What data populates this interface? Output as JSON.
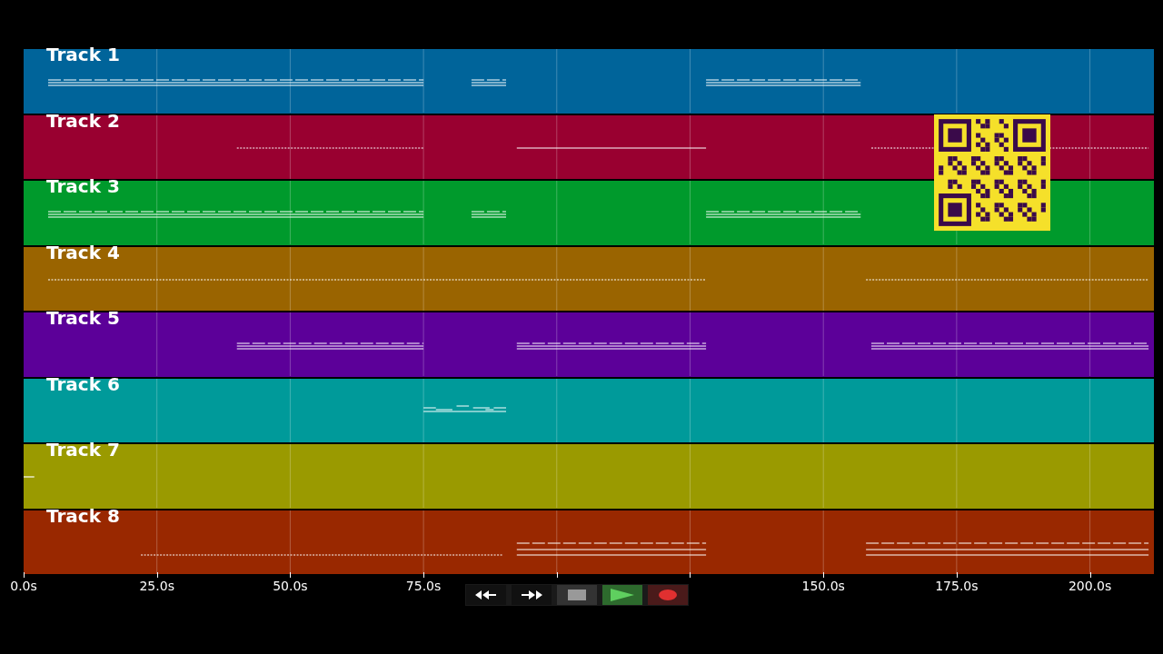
{
  "tracks": [
    {
      "name": "Track 1",
      "color": "#00649a"
    },
    {
      "name": "Track 2",
      "color": "#990030"
    },
    {
      "name": "Track 3",
      "color": "#009a2c"
    },
    {
      "name": "Track 4",
      "color": "#9a6400"
    },
    {
      "name": "Track 5",
      "color": "#5c0099"
    },
    {
      "name": "Track 6",
      "color": "#009a9a"
    },
    {
      "name": "Track 7",
      "color": "#9a9a00"
    },
    {
      "name": "Track 8",
      "color": "#992800"
    }
  ],
  "time_axis": {
    "labels": [
      "0.0s",
      "25.0s",
      "50.0s",
      "75.0s",
      "150.0s",
      "175.0s",
      "200.0s"
    ]
  },
  "transport": [
    {
      "kind": "rewind"
    },
    {
      "kind": "forward"
    },
    {
      "kind": "stop"
    },
    {
      "kind": "play"
    },
    {
      "kind": "record"
    }
  ],
  "qr_code": {
    "kind": "qr"
  }
}
